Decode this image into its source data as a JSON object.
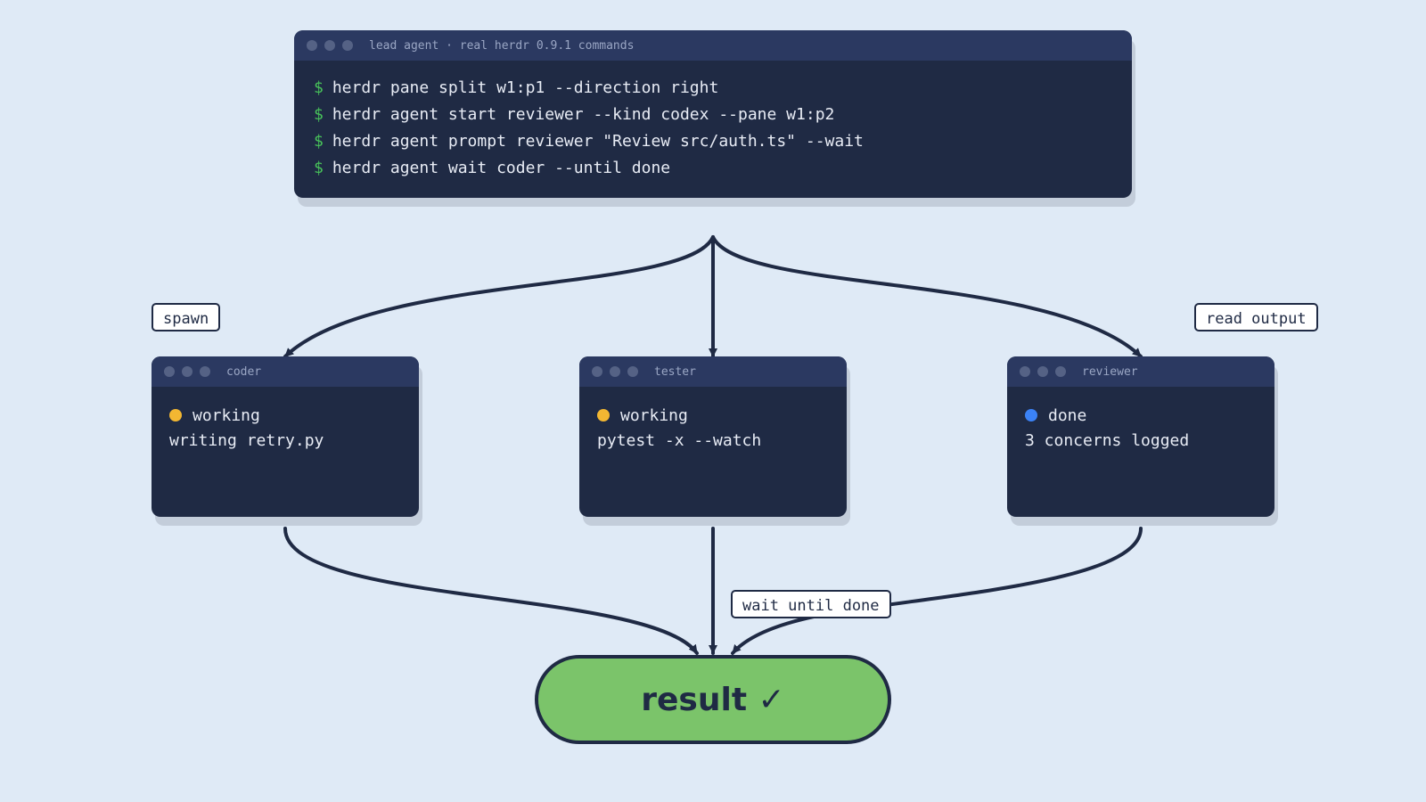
{
  "lead_terminal": {
    "title": "lead agent · real herdr 0.9.1 commands",
    "prompt_symbol": "$",
    "commands": [
      "herdr pane split w1:p1 --direction right",
      "herdr agent start reviewer --kind codex --pane w1:p2",
      "herdr agent prompt reviewer \"Review src/auth.ts\" --wait",
      "herdr agent wait coder --until done"
    ]
  },
  "agents": [
    {
      "title": "coder",
      "status": "working",
      "status_color": "#f2b732",
      "detail": "writing retry.py"
    },
    {
      "title": "tester",
      "status": "working",
      "status_color": "#f2b732",
      "detail": "pytest -x --watch"
    },
    {
      "title": "reviewer",
      "status": "done",
      "status_color": "#3b82f6",
      "detail": "3 concerns logged"
    }
  ],
  "labels": {
    "spawn": "spawn",
    "read_output": "read output",
    "wait": "wait until done"
  },
  "result": {
    "label": "result ✓",
    "color": "#7bc46a"
  },
  "colors": {
    "background": "#dfeaf6",
    "terminal": "#1f2a44",
    "terminal_bar": "#2b3961",
    "prompt": "#48c25a",
    "stroke": "#1f2a44"
  }
}
